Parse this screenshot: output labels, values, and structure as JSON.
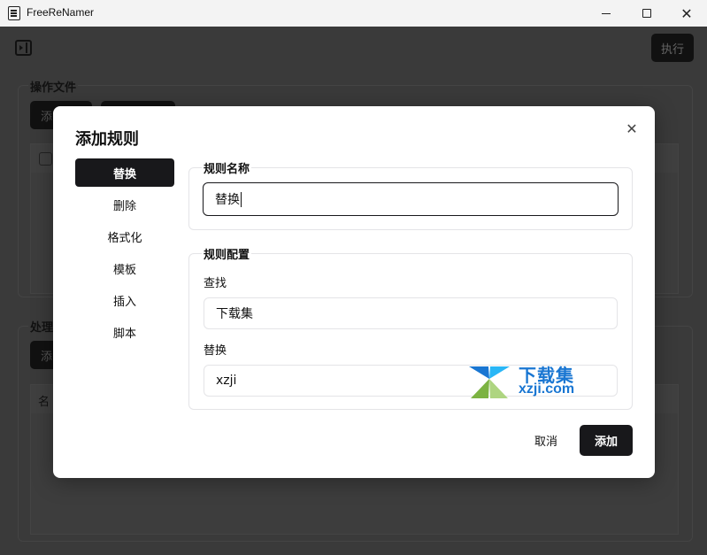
{
  "window": {
    "title": "FreeReNamer",
    "close_glyph": "✕"
  },
  "app": {
    "execute_label": "执行",
    "section_files_label": "操作文件",
    "section_process_label": "处理",
    "add_partial": "添",
    "column_name_partial": "名"
  },
  "modal": {
    "title": "添加规则",
    "close_glyph": "✕",
    "tabs": [
      {
        "label": "替换",
        "active": true
      },
      {
        "label": "删除",
        "active": false
      },
      {
        "label": "格式化",
        "active": false
      },
      {
        "label": "模板",
        "active": false
      },
      {
        "label": "插入",
        "active": false
      },
      {
        "label": "脚本",
        "active": false
      }
    ],
    "rule_name": {
      "legend": "规则名称",
      "value": "替换"
    },
    "rule_config": {
      "legend": "规则配置",
      "find_label": "查找",
      "find_value": "下载集",
      "replace_label": "替换",
      "replace_value": "xzji"
    },
    "cancel_label": "取消",
    "add_label": "添加"
  },
  "watermark": {
    "cn": "下载集",
    "en": "xzji.com"
  },
  "colors": {
    "primary": "#18181b",
    "overlay": "#3a3a3a",
    "watermark_blue": "#1976d2",
    "watermark_green": "#7cb342"
  }
}
